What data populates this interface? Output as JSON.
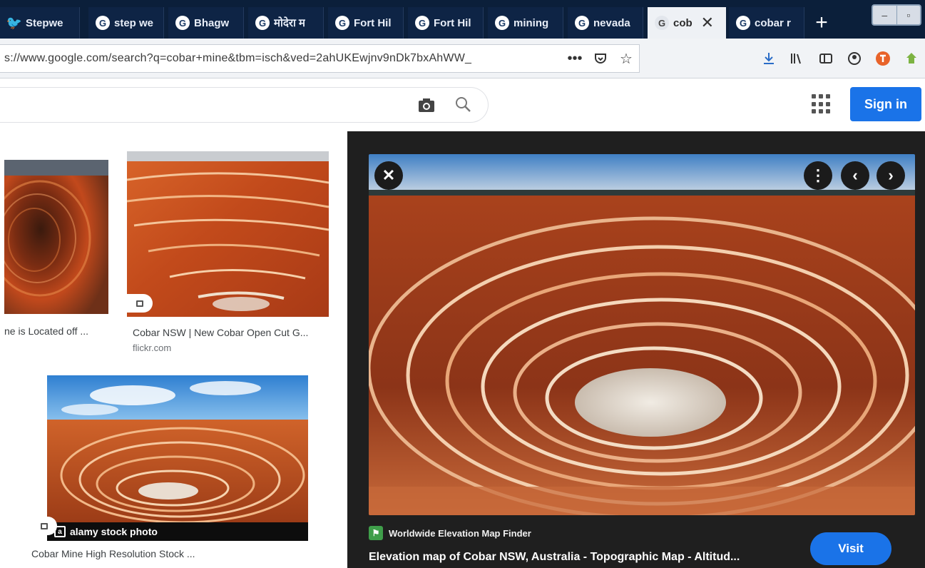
{
  "browser": {
    "tabs": [
      {
        "title": "Stepwe",
        "favicon": "twitter-icon"
      },
      {
        "title": "step we",
        "favicon": "google-icon"
      },
      {
        "title": "Bhagw",
        "favicon": "google-icon"
      },
      {
        "title": "मोदेरा म",
        "favicon": "google-icon"
      },
      {
        "title": "Fort Hil",
        "favicon": "google-icon"
      },
      {
        "title": "Fort Hil",
        "favicon": "google-icon"
      },
      {
        "title": "mining",
        "favicon": "google-icon"
      },
      {
        "title": "nevada",
        "favicon": "google-icon"
      },
      {
        "title": "cob",
        "favicon": "google-icon",
        "active": true
      },
      {
        "title": "cobar r",
        "favicon": "google-icon"
      }
    ],
    "url": "s://www.google.com/search?q=cobar+mine&tbm=isch&ved=2ahUKEwjnv9nDk7bxAhWW_",
    "url_overflow": "•••"
  },
  "google": {
    "signin_label": "Sign in"
  },
  "results": [
    {
      "caption": "ne is Located off ...",
      "site": ""
    },
    {
      "caption": "Cobar NSW | New Cobar Open Cut G...",
      "site": "flickr.com"
    },
    {
      "caption": "Cobar Mine High Resolution Stock ...",
      "site": "",
      "overlay": "alamy stock photo"
    }
  ],
  "preview": {
    "source": "Worldwide Elevation Map Finder",
    "title": "Elevation map of Cobar NSW, Australia - Topographic Map - Altitud...",
    "visit_label": "Visit"
  },
  "colors": {
    "tab_strip": "#0b1f3a",
    "accent_blue": "#1a73e8",
    "preview_bg": "#1f1f1f",
    "mine_red": "#b8431e"
  }
}
